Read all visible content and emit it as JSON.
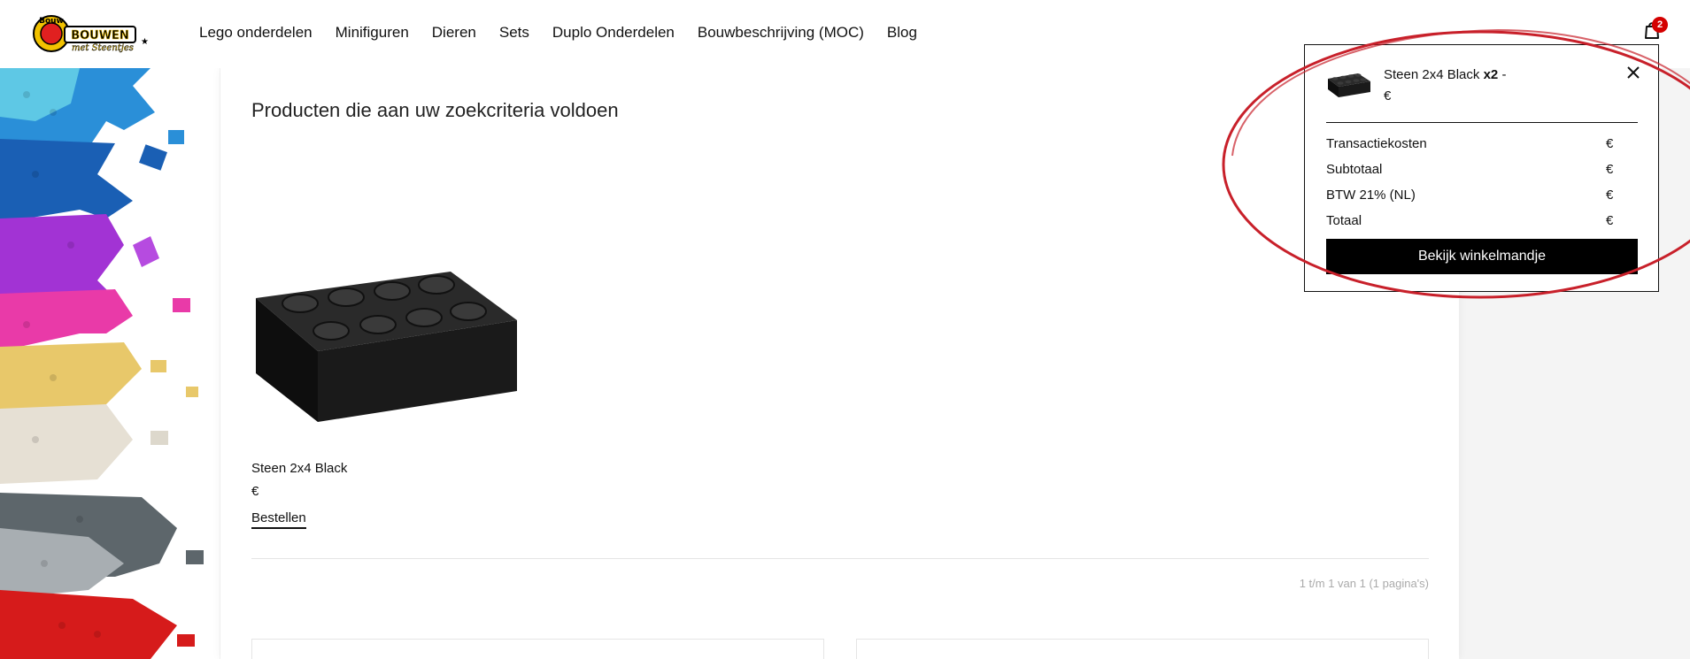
{
  "brand": {
    "logo_alt": "Bouwen met Steentjes logo"
  },
  "nav": {
    "items": [
      "Lego onderdelen",
      "Minifiguren",
      "Dieren",
      "Sets",
      "Duplo Onderdelen",
      "Bouwbeschrijving (MOC)",
      "Blog"
    ]
  },
  "header": {
    "cart_count": "2",
    "cart_icon": "shopping-bag-icon"
  },
  "main": {
    "heading": "Producten die aan uw zoekcriteria voldoen",
    "product": {
      "name": "Steen 2x4 Black",
      "price": "€",
      "order_label": "Bestellen"
    },
    "pagination": "1 t/m 1 van 1 (1 pagina's)"
  },
  "cart": {
    "item_name": "Steen 2x4 Black",
    "item_qty": "x2",
    "item_dash": "-",
    "item_price": "€",
    "close_icon": "close-icon",
    "rows": [
      {
        "label": "Transactiekosten",
        "value": "€"
      },
      {
        "label": "Subtotaal",
        "value": "€"
      },
      {
        "label": "BTW 21% (NL)",
        "value": "€"
      },
      {
        "label": "Totaal",
        "value": "€"
      }
    ],
    "cta_label": "Bekijk winkelmandje"
  },
  "colors": {
    "accent_red": "#c8202a",
    "badge_red": "#d40000",
    "cta_black": "#000000"
  }
}
